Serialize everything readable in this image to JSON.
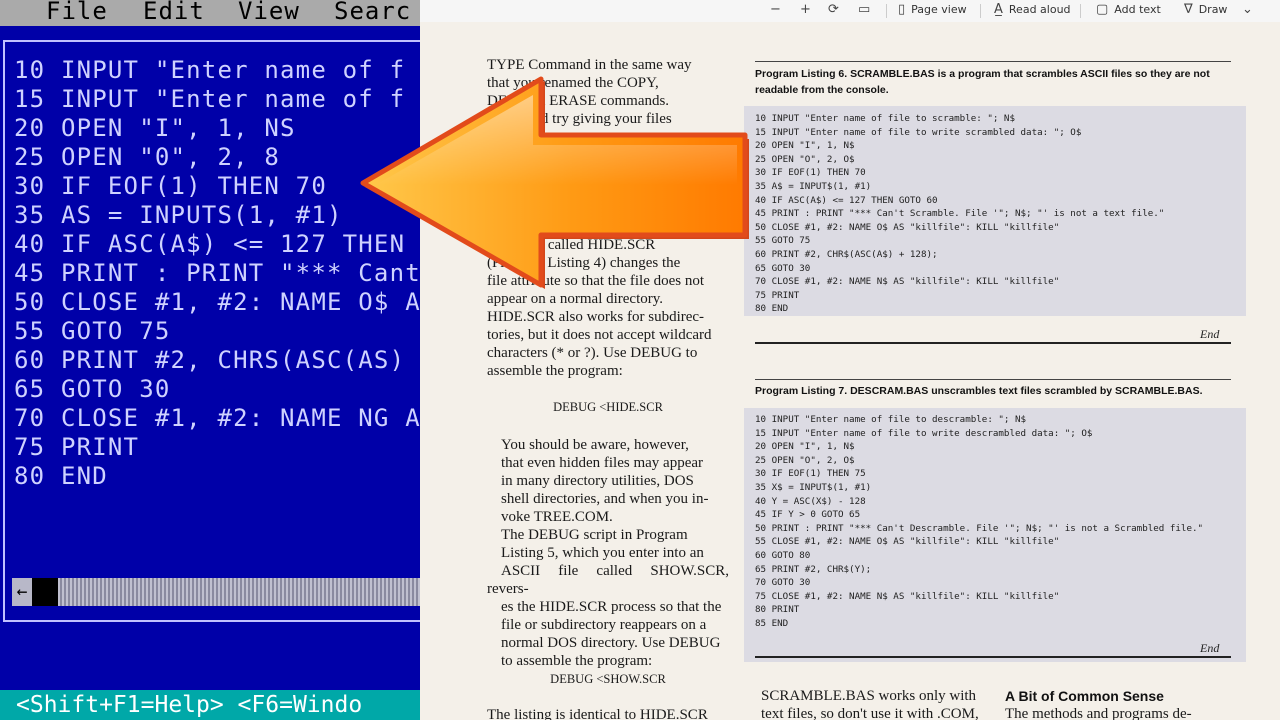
{
  "dos": {
    "menu": [
      "File",
      "Edit",
      "View",
      "Searc"
    ],
    "code_lines": [
      "10 INPUT \"Enter name of f",
      "15 INPUT \"Enter name of f",
      "20 OPEN \"I\", 1, NS",
      "25 OPEN \"0\", 2, 8",
      "30 IF EOF(1) THEN 70",
      "35 AS = INPUTS(1, #1)",
      "40 IF ASC(A$) <= 127 THEN",
      "45 PRINT : PRINT \"*** Cant",
      "50 CLOSE #1, #2: NAME O$ A",
      "55 GOTO 75",
      "60 PRINT #2, CHRS(ASC(AS)",
      "65 GOTO 30",
      "70 CLOSE #1, #2: NAME NG A",
      "75 PRINT",
      "80 END"
    ],
    "scroll_arrow": "←",
    "status": "<Shift+F1=Help> <F6=Windo"
  },
  "toolbar": {
    "minus": "−",
    "plus": "+",
    "page_view": "Page view",
    "read_aloud": "Read aloud",
    "add_text": "Add text",
    "draw": "Draw"
  },
  "article": {
    "col1_top": [
      "TYPE Command in the same way",
      "that you renamed the COPY,",
      "DEL, and ERASE commands.",
      "You could try giving your files"
    ],
    "col1_mid": [
      "script file called HIDE.SCR",
      "(Program Listing 4) changes the",
      "file attribute so that the file does not",
      "appear on a normal directory.",
      "HIDE.SCR also works for subdirec-",
      "tories, but it does not accept wildcard",
      "characters (* or ?). Use DEBUG to",
      "assemble the program:"
    ],
    "debug_hide": "DEBUG <HIDE.SCR",
    "para_aware": [
      "You should be aware, however,",
      "that even hidden files may appear",
      "in many directory utilities, DOS",
      "shell directories, and when you in-",
      "voke TREE.COM."
    ],
    "para_debug": [
      "The DEBUG script in Program",
      "Listing 5, which you enter into an",
      "ASCII file called SHOW.SCR, revers-",
      "es the HIDE.SCR process so that the",
      "file or subdirectory reappears on a",
      "normal DOS directory. Use DEBUG",
      "to assemble the program:"
    ],
    "debug_show": "DEBUG <SHOW.SCR",
    "col1_bottom": "The listing is identical to HIDE.SCR",
    "listing6_title": "Program Listing 6. SCRAMBLE.BAS is a program that scrambles ASCII files so they are not readable from the console.",
    "listing6_code": [
      "10 INPUT \"Enter name of file to scramble: \"; N$",
      "15 INPUT \"Enter name of file to write scrambled data: \"; O$",
      "20 OPEN \"I\", 1, N$",
      "25 OPEN \"O\", 2, O$",
      "30 IF EOF(1) THEN 70",
      "35 A$ = INPUT$(1, #1)",
      "40 IF ASC(A$) <= 127 THEN GOTO 60",
      "45 PRINT : PRINT \"*** Can't Scramble. File '\"; N$; \"' is not a text file.\"",
      "50 CLOSE #1, #2: NAME O$ AS \"killfile\": KILL \"killfile\"",
      "55 GOTO 75",
      "60 PRINT #2, CHR$(ASC(A$) + 128);",
      "65 GOTO 30",
      "70 CLOSE #1, #2: NAME N$ AS \"killfile\": KILL \"killfile\"",
      "75 PRINT",
      "80 END"
    ],
    "end1": "End",
    "listing7_title": "Program Listing 7. DESCRAM.BAS unscrambles text files scrambled by SCRAMBLE.BAS.",
    "listing7_code": [
      "10 INPUT \"Enter name of file to descramble: \"; N$",
      "15 INPUT \"Enter name of file to write descrambled data: \"; O$",
      "20 OPEN \"I\", 1, N$",
      "25 OPEN \"O\", 2, O$",
      "30 IF EOF(1) THEN 75",
      "35 X$ = INPUT$(1, #1)",
      "40 Y = ASC(X$) - 128",
      "45 IF Y > 0 GOTO 65",
      "50 PRINT : PRINT \"*** Can't Descramble. File '\"; N$; \"' is not a Scrambled file.\"",
      "55 CLOSE #1, #2: NAME O$ AS \"killfile\": KILL \"killfile\"",
      "60 GOTO 80",
      "65 PRINT #2, CHR$(Y);",
      "70 GOTO 30",
      "75 CLOSE #1, #2: NAME N$ AS \"killfile\": KILL \"killfile\"",
      "80 PRINT",
      "85 END"
    ],
    "end2": "End",
    "bottom_para_lines": [
      "SCRAMBLE.BAS works only with",
      "text files, so don't use it with .COM,"
    ],
    "side_heading": "A Bit of Common Sense",
    "side_text": "The methods and programs de-"
  },
  "colors": {
    "dos_blue": "#0000a8",
    "dos_text": "#cfd2ff",
    "dos_status": "#00a8a8",
    "arrow_orange": "#ff8a00"
  },
  "icons": [
    "minus-icon",
    "plus-icon",
    "rotate-icon",
    "fit-icon",
    "page-view-icon",
    "read-aloud-icon",
    "add-text-icon",
    "draw-icon",
    "chevron-down-icon",
    "arrow-left-icon"
  ]
}
